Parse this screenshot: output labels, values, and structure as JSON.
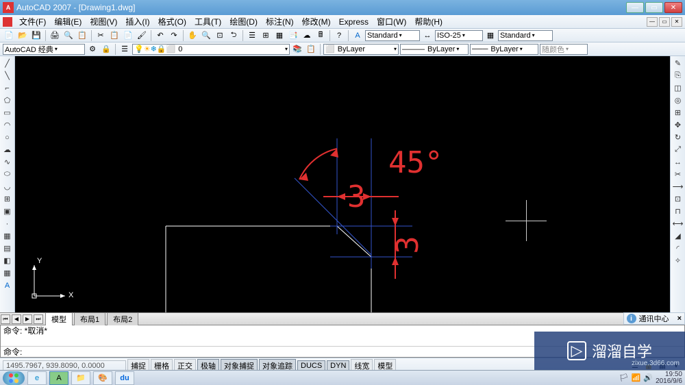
{
  "title": "AutoCAD 2007 - [Drawing1.dwg]",
  "menus": [
    "文件(F)",
    "编辑(E)",
    "视图(V)",
    "插入(I)",
    "格式(O)",
    "工具(T)",
    "绘图(D)",
    "标注(N)",
    "修改(M)",
    "Express",
    "窗口(W)",
    "帮助(H)"
  ],
  "workspace_combo": "AutoCAD 经典",
  "layer_combo": "0",
  "style1": "Standard",
  "dimstyle": "ISO-25",
  "style2": "Standard",
  "bylayer1": "ByLayer",
  "bylayer2": "ByLayer",
  "bylayer3": "ByLayer",
  "color_combo": "随颜色",
  "tabs": {
    "model": "模型",
    "layout1": "布局1",
    "layout2": "布局2"
  },
  "notice": "通讯中心",
  "cmd_history": "命令: *取消*",
  "cmd_prompt": "命令:",
  "coords": "1495.7967, 939.8090, 0.0000",
  "osnap_buttons": [
    "捕捉",
    "栅格",
    "正交",
    "极轴",
    "对象捕捉",
    "对象追踪",
    "DUCS",
    "DYN",
    "线宽",
    "模型"
  ],
  "drawing_text": {
    "angle": "45°",
    "dim1": "3",
    "dim2": "3"
  },
  "ucs": {
    "x": "X",
    "y": "Y"
  },
  "watermark": {
    "text": "溜溜自学",
    "url": "zixue.3d66.com"
  },
  "clock": {
    "time": "19:50",
    "date": "2016/9/6"
  }
}
